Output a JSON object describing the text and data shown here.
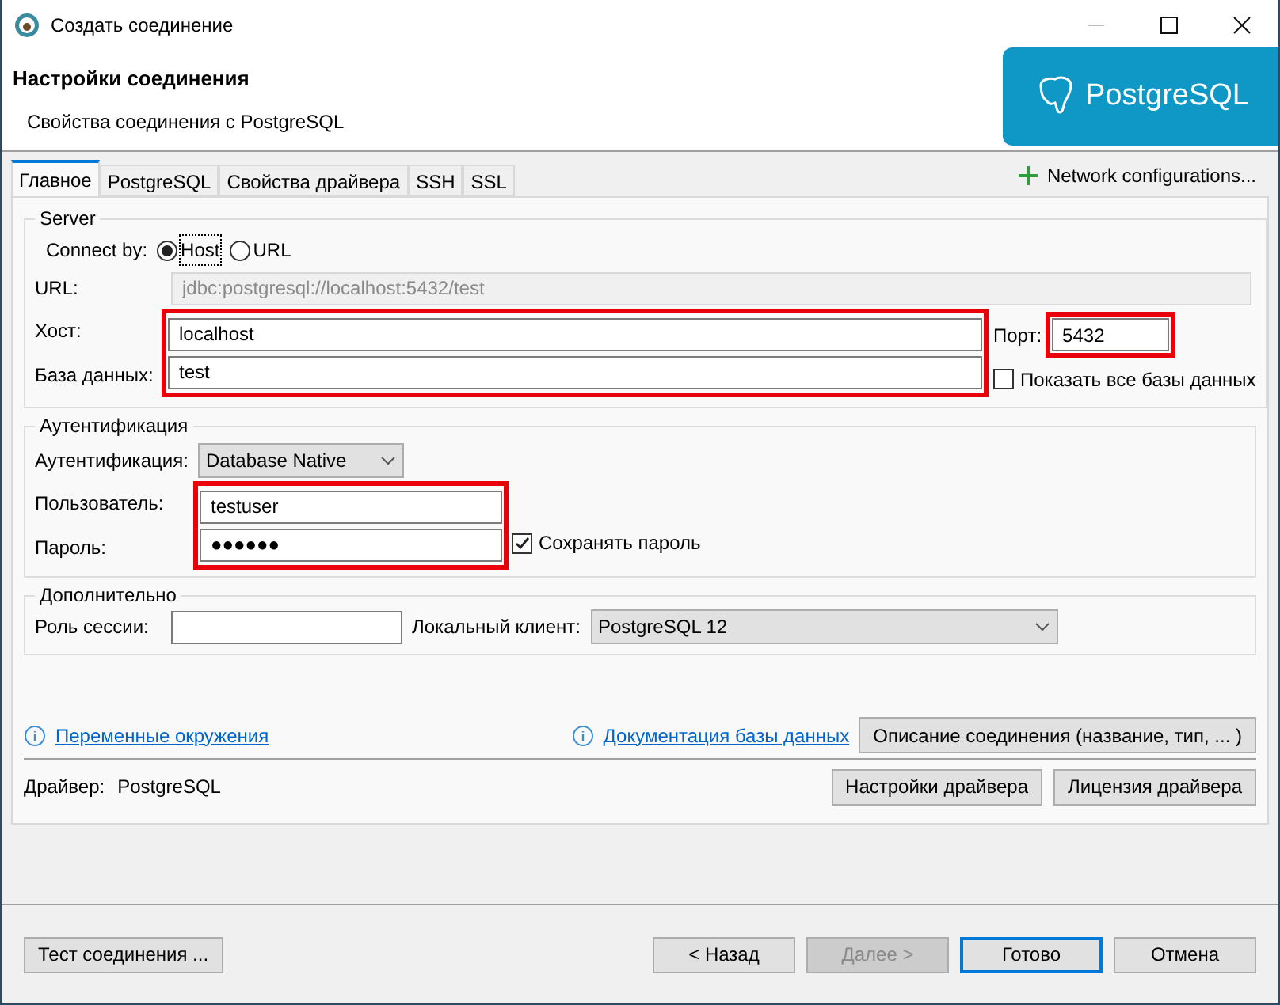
{
  "window": {
    "title": "Создать соединение"
  },
  "header": {
    "title": "Настройки соединения",
    "subtitle": "Свойства соединения с PostgreSQL",
    "logo_text": "PostgreSQL"
  },
  "tabs": [
    {
      "label": "Главное",
      "selected": true
    },
    {
      "label": "PostgreSQL",
      "selected": false
    },
    {
      "label": "Свойства драйвера",
      "selected": false
    },
    {
      "label": "SSH",
      "selected": false
    },
    {
      "label": "SSL",
      "selected": false
    }
  ],
  "network_configurations": "Network configurations...",
  "server": {
    "title": "Server",
    "connect_by_label": "Connect by:",
    "connect_by": [
      {
        "label": "Host",
        "selected": true
      },
      {
        "label": "URL",
        "selected": false
      }
    ],
    "url_label": "URL:",
    "url_value": "jdbc:postgresql://localhost:5432/test",
    "url_disabled": true,
    "host_label": "Хост:",
    "host_value": "localhost",
    "port_label": "Порт:",
    "port_value": "5432",
    "database_label": "База данных:",
    "database_value": "test",
    "show_all_databases": {
      "label": "Показать все базы данных",
      "checked": false
    }
  },
  "authentication": {
    "title": "Аутентификация",
    "auth_label": "Аутентификация:",
    "auth_value": "Database Native",
    "user_label": "Пользователь:",
    "user_value": "testuser",
    "password_label": "Пароль:",
    "password_value": "●●●●●●",
    "save_password": {
      "label": "Сохранять пароль",
      "checked": true
    }
  },
  "advanced": {
    "title": "Дополнительно",
    "role_label": "Роль сессии:",
    "client_label": "Локальный клиент:",
    "client_value": "PostgreSQL 12"
  },
  "links": [
    "Переменные окружения",
    "Документация базы данных"
  ],
  "connection_details_button": "Описание соединения (название, тип, ... )",
  "driver": {
    "label": "Драйвер:",
    "name": "PostgreSQL"
  },
  "driver_buttons": [
    "Настройки драйвера",
    "Лицензия драйвера"
  ],
  "test_button": "Тест соединения ...",
  "footer_buttons": [
    {
      "label": "< Назад",
      "disabled": false,
      "default": false
    },
    {
      "label": "Далее >",
      "disabled": true,
      "default": false
    },
    {
      "label": "Готово",
      "disabled": false,
      "default": true
    },
    {
      "label": "Отмена",
      "disabled": false,
      "default": false
    }
  ]
}
